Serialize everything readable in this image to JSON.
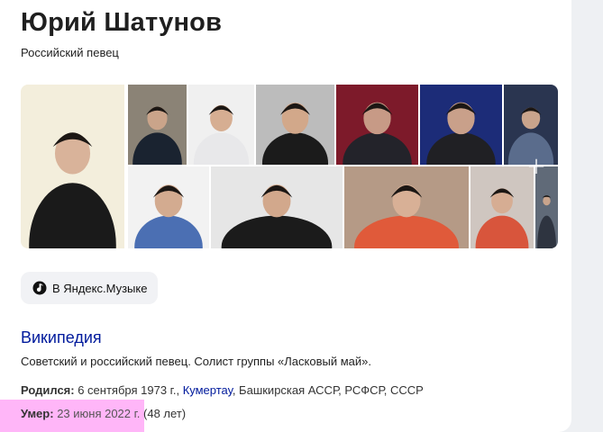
{
  "entity": {
    "name": "Юрий Шатунов",
    "subtitle": "Российский певец"
  },
  "gallery": {
    "more_icon": "plus-icon",
    "photos": [
      {
        "bg": "#f3eedc",
        "fg": "#1a1a1a",
        "face": "#d9b39a"
      },
      {
        "bg": "#8b8376",
        "fg": "#1a2330",
        "face": "#caa48a"
      },
      {
        "bg": "#f0f0f0",
        "fg": "#e8e8ea",
        "face": "#d6ae92"
      },
      {
        "bg": "#bcbcbc",
        "fg": "#1b1b1b",
        "face": "#d2a88a"
      },
      {
        "bg": "#7d1a2a",
        "fg": "#23232a",
        "face": "#c79a86"
      },
      {
        "bg": "#1c2c78",
        "fg": "#202024",
        "face": "#c9a08a"
      },
      {
        "bg": "#2a3550",
        "fg": "#5a6c8c",
        "face": "#c9a48c"
      },
      {
        "bg": "#f2f2f2",
        "fg": "#4b6fb3",
        "face": "#d3ab90"
      },
      {
        "bg": "#e6e6e6",
        "fg": "#1b1b1b",
        "face": "#d2a88c"
      },
      {
        "bg": "#b59a86",
        "fg": "#e05a3a",
        "face": "#d8b096"
      },
      {
        "bg": "#cfc6c0",
        "fg": "#d8553c",
        "face": "#d6ad93"
      },
      {
        "bg": "#606a78",
        "fg": "#2e3440",
        "face": "#c9a48c"
      }
    ]
  },
  "music_button": {
    "label": "В Яндекс.Музыке",
    "icon": "yandex-music-icon"
  },
  "wiki": {
    "source": "Википедия",
    "description": "Советский и российский певец. Солист группы «Ласковый май»."
  },
  "facts": {
    "born_label": "Родился:",
    "born_date": "6 сентября 1973 г.,",
    "born_place_link": "Кумертау",
    "born_place_rest": ", Башкирская АССР, РСФСР, СССР",
    "died_label": "Умер:",
    "died_date": "23 июня 2022 г.",
    "died_age": "(48 лет)"
  }
}
